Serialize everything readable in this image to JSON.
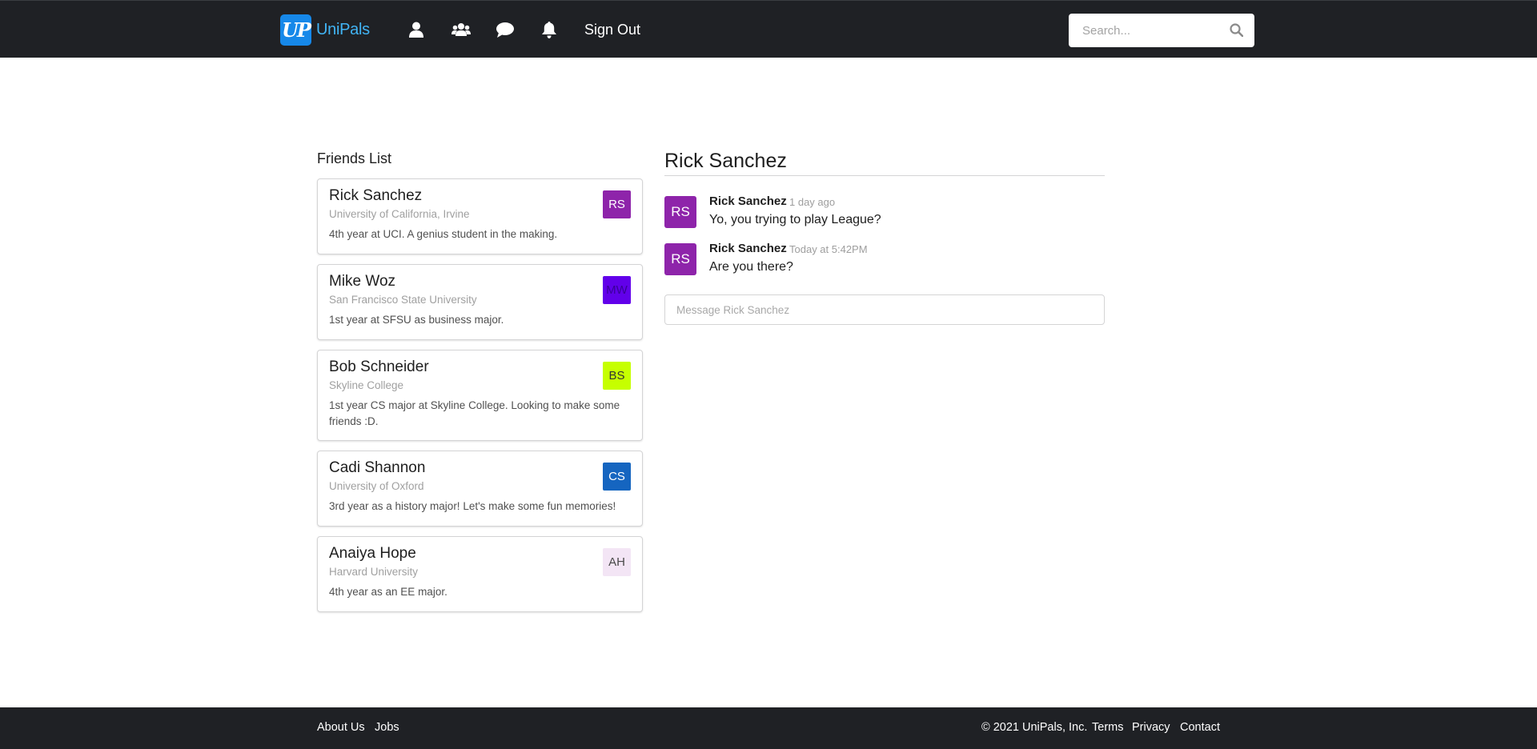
{
  "brand": {
    "logo_text": "UP",
    "name": "UniPals"
  },
  "nav": {
    "icons": [
      "user-icon",
      "users-icon",
      "comment-icon",
      "bell-icon"
    ],
    "sign_out": "Sign Out"
  },
  "search": {
    "placeholder": "Search..."
  },
  "friends": {
    "title": "Friends List",
    "items": [
      {
        "name": "Rick Sanchez",
        "school": "University of California, Irvine",
        "description": "4th year at UCI. A genius student in the making.",
        "initials": "RS",
        "avatar_bg": "#8e24aa",
        "avatar_fg": "#ffffff"
      },
      {
        "name": "Mike Woz",
        "school": "San Francisco State University",
        "description": "1st year at SFSU as business major.",
        "initials": "MW",
        "avatar_bg": "#6200ea",
        "avatar_fg": "#3a0099"
      },
      {
        "name": "Bob Schneider",
        "school": "Skyline College",
        "description": "1st year CS major at Skyline College. Looking to make some friends :D.",
        "initials": "BS",
        "avatar_bg": "#c6ff00",
        "avatar_fg": "#333333"
      },
      {
        "name": "Cadi Shannon",
        "school": "University of Oxford",
        "description": "3rd year as a history major! Let's make some fun memories!",
        "initials": "CS",
        "avatar_bg": "#1565c0",
        "avatar_fg": "#ffffff"
      },
      {
        "name": "Anaiya Hope",
        "school": "Harvard University",
        "description": "4th year as an EE major.",
        "initials": "AH",
        "avatar_bg": "#f3e5f5",
        "avatar_fg": "#4a4a4a"
      }
    ]
  },
  "chat": {
    "title": "Rick Sanchez",
    "messages": [
      {
        "author": "Rick Sanchez",
        "time": "1 day ago",
        "text": "Yo, you trying to play League?",
        "initials": "RS",
        "avatar_bg": "#8e24aa"
      },
      {
        "author": "Rick Sanchez",
        "time": "Today at 5:42PM",
        "text": "Are you there?",
        "initials": "RS",
        "avatar_bg": "#8e24aa"
      }
    ],
    "input_placeholder": "Message Rick Sanchez"
  },
  "footer": {
    "about": "About Us",
    "jobs": "Jobs",
    "copyright": "© 2021 UniPals, Inc.",
    "terms": "Terms",
    "privacy": "Privacy",
    "contact": "Contact"
  }
}
